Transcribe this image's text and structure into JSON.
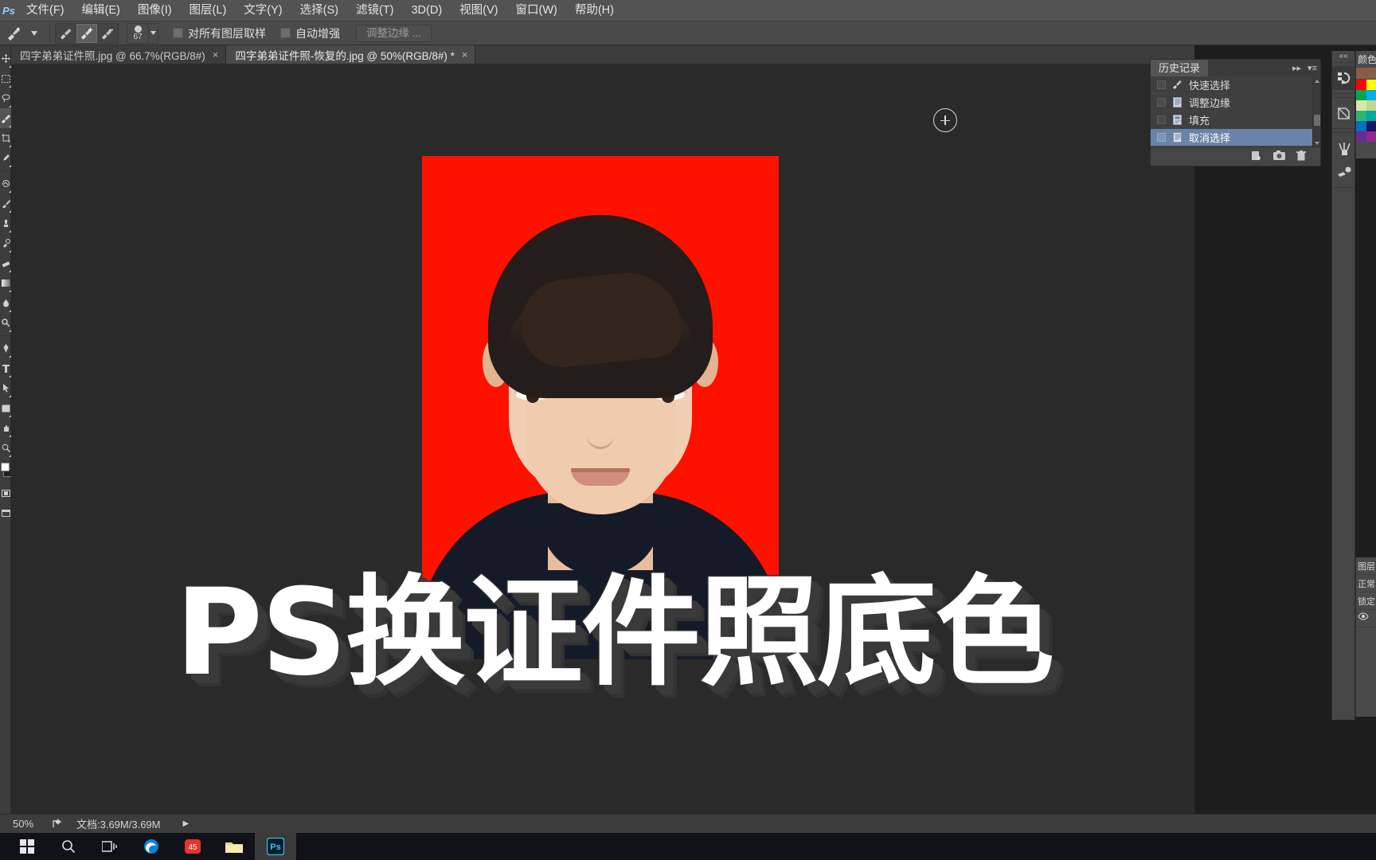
{
  "menubar": {
    "logo": "Ps",
    "items": [
      {
        "label": "文件(F)"
      },
      {
        "label": "编辑(E)"
      },
      {
        "label": "图像(I)"
      },
      {
        "label": "图层(L)"
      },
      {
        "label": "文字(Y)"
      },
      {
        "label": "选择(S)"
      },
      {
        "label": "滤镜(T)"
      },
      {
        "label": "3D(D)"
      },
      {
        "label": "视图(V)"
      },
      {
        "label": "窗口(W)"
      },
      {
        "label": "帮助(H)"
      }
    ]
  },
  "options": {
    "tool_icon": "quick-selection-brush-icon",
    "mode_new": "new-selection-icon",
    "mode_add": "add-to-selection-icon",
    "mode_subtract": "subtract-from-selection-icon",
    "brush_size": "67",
    "sample_all_layers": "对所有图层取样",
    "auto_enhance": "自动增强",
    "refine_edge": "调整边缘 ..."
  },
  "tabs": [
    {
      "label": "四字弟弟证件照.jpg @ 66.7%(RGB/8#)",
      "close": "×",
      "active": false
    },
    {
      "label": "四字弟弟证件照-恢复的.jpg @ 50%(RGB/8#) *",
      "close": "×",
      "active": true
    }
  ],
  "history": {
    "title": "历史记录",
    "collapse_icon": "double-chevron-right-icon",
    "menu_icon": "panel-menu-icon",
    "items": [
      {
        "label": "快速选择",
        "icon": "quick-selection-icon",
        "selected": false
      },
      {
        "label": "调整边缘",
        "icon": "document-icon",
        "selected": false
      },
      {
        "label": "填充",
        "icon": "fill-icon",
        "selected": false
      },
      {
        "label": "取消选择",
        "icon": "deselect-icon",
        "selected": true
      }
    ],
    "footer_icons": [
      "new-document-from-state-icon",
      "create-snapshot-icon",
      "delete-state-icon"
    ]
  },
  "rail": {
    "collapse": "««",
    "buttons": [
      {
        "name": "history-rail-icon",
        "on": true
      },
      {
        "name": "layer-comps-rail-icon",
        "on": false
      },
      {
        "name": "brush-presets-rail-icon",
        "on": false
      },
      {
        "name": "tool-presets-rail-icon",
        "on": false
      }
    ]
  },
  "swatches": {
    "title": "颜色",
    "strip_color": "#8a5c46",
    "colors": [
      "#ff0000",
      "#ffff00",
      "#00a651",
      "#00aeef",
      "#d7e8a8",
      "#bcd98c",
      "#2bb673",
      "#00a99d",
      "#0072bc",
      "#1b1464",
      "#662d91",
      "#92278f"
    ]
  },
  "layers_panel": {
    "rows": [
      "图层",
      "正常",
      "锁定",
      "眼睛"
    ]
  },
  "canvas": {
    "photo": {
      "background_color": "#ff1100",
      "alt": "portrait-photo-red-background"
    },
    "brush_cursor": "brush-cursor-crosshair"
  },
  "title_overlay": {
    "text": "PS换证件照底色"
  },
  "statusbar": {
    "zoom": "50%",
    "share_icon": "share-icon",
    "doc": "文档:3.69M/3.69M",
    "arrow": "▶"
  },
  "taskbar": {
    "items": [
      {
        "name": "start-windows-icon"
      },
      {
        "name": "search-icon"
      },
      {
        "name": "task-view-icon"
      },
      {
        "name": "edge-browser-icon"
      },
      {
        "name": "red-app-icon"
      },
      {
        "name": "file-explorer-icon"
      },
      {
        "name": "photoshop-taskbar-icon",
        "active": true
      }
    ]
  },
  "left_toolbar": {
    "tools": [
      {
        "name": "move-tool"
      },
      {
        "name": "marquee-tool"
      },
      {
        "name": "lasso-tool"
      },
      {
        "name": "quick-selection-tool",
        "selected": true
      },
      {
        "name": "crop-tool"
      },
      {
        "name": "eyedropper-tool"
      },
      {
        "name": "spot-healing-tool"
      },
      {
        "name": "brush-tool"
      },
      {
        "name": "clone-stamp-tool"
      },
      {
        "name": "history-brush-tool"
      },
      {
        "name": "eraser-tool"
      },
      {
        "name": "gradient-tool"
      },
      {
        "name": "blur-tool"
      },
      {
        "name": "dodge-tool"
      },
      {
        "name": "pen-tool"
      },
      {
        "name": "type-tool"
      },
      {
        "name": "path-selection-tool"
      },
      {
        "name": "shape-tool"
      },
      {
        "name": "hand-tool"
      },
      {
        "name": "zoom-tool"
      }
    ]
  }
}
